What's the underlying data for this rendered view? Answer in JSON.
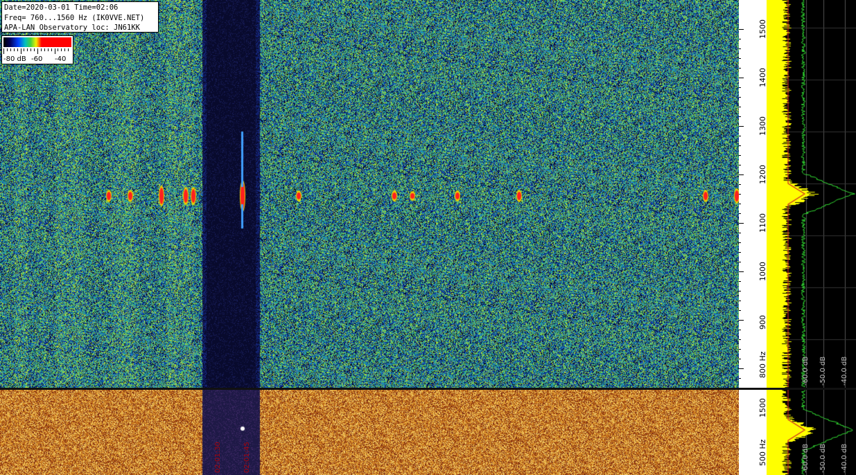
{
  "header": {
    "date_line": "Date=2020-03-01 Time=02:06",
    "freq_line": "Freq= 760...1560 Hz (IK0VVE.NET)",
    "observatory_line": "APA-LAN Observatory loc: JN61KK"
  },
  "legend": {
    "labels": [
      "-80 dB",
      "-60",
      "-40"
    ]
  },
  "top_axis": {
    "ticks": [
      "1500",
      "1400",
      "1300",
      "1200",
      "1100",
      "1000",
      "900",
      "800 Hz"
    ],
    "tick_values_hz": [
      1500,
      1400,
      1300,
      1200,
      1100,
      1000,
      900,
      800
    ],
    "range_hz": [
      760,
      1560
    ]
  },
  "bottom_axis": {
    "ticks": [
      "1500",
      "500 Hz"
    ]
  },
  "spectrum": {
    "top_db_labels": [
      "-60.0 dB",
      "-50.0 dB",
      "-40.0 dB"
    ],
    "bottom_db_labels": [
      "-60.0 dB",
      "-50.0 dB",
      "-40.0 dB"
    ],
    "peak_hz": 1160
  },
  "time_labels": [
    "02:01:30",
    "02:01:45"
  ],
  "colors": {
    "trace_yellow": "#ffff00",
    "trace_green": "#33dd33",
    "trace_red": "#cc2222",
    "event_red": "#ff2020"
  }
}
